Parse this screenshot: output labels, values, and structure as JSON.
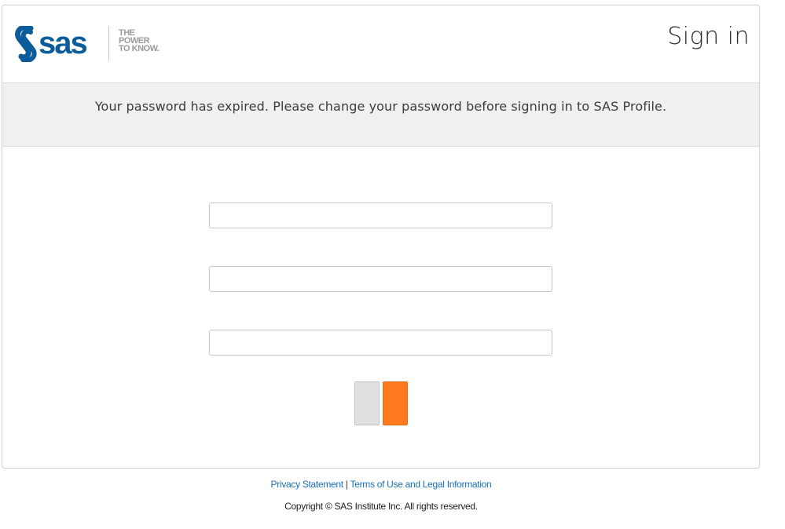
{
  "header": {
    "logo_wordmark": "sas",
    "logo_tagline": [
      "THE",
      "POWER",
      "TO KNOW."
    ],
    "title": "Sign in"
  },
  "notice": {
    "message": "Your password has expired. Please change your password before signing in to SAS Profile."
  },
  "form": {
    "fields": [
      {
        "value": "",
        "placeholder": ""
      },
      {
        "value": "",
        "placeholder": ""
      },
      {
        "value": "",
        "placeholder": ""
      }
    ],
    "cancel_label": "",
    "submit_label": ""
  },
  "footer": {
    "privacy_label": "Privacy Statement",
    "separator": "|",
    "terms_label": "Terms of Use and Legal Information",
    "copyright": "Copyright © SAS Institute Inc. All rights reserved."
  },
  "colors": {
    "brand_blue": "#0c5b9b",
    "accent_orange": "#ff7a1f",
    "link_blue": "#1a6fb5"
  }
}
